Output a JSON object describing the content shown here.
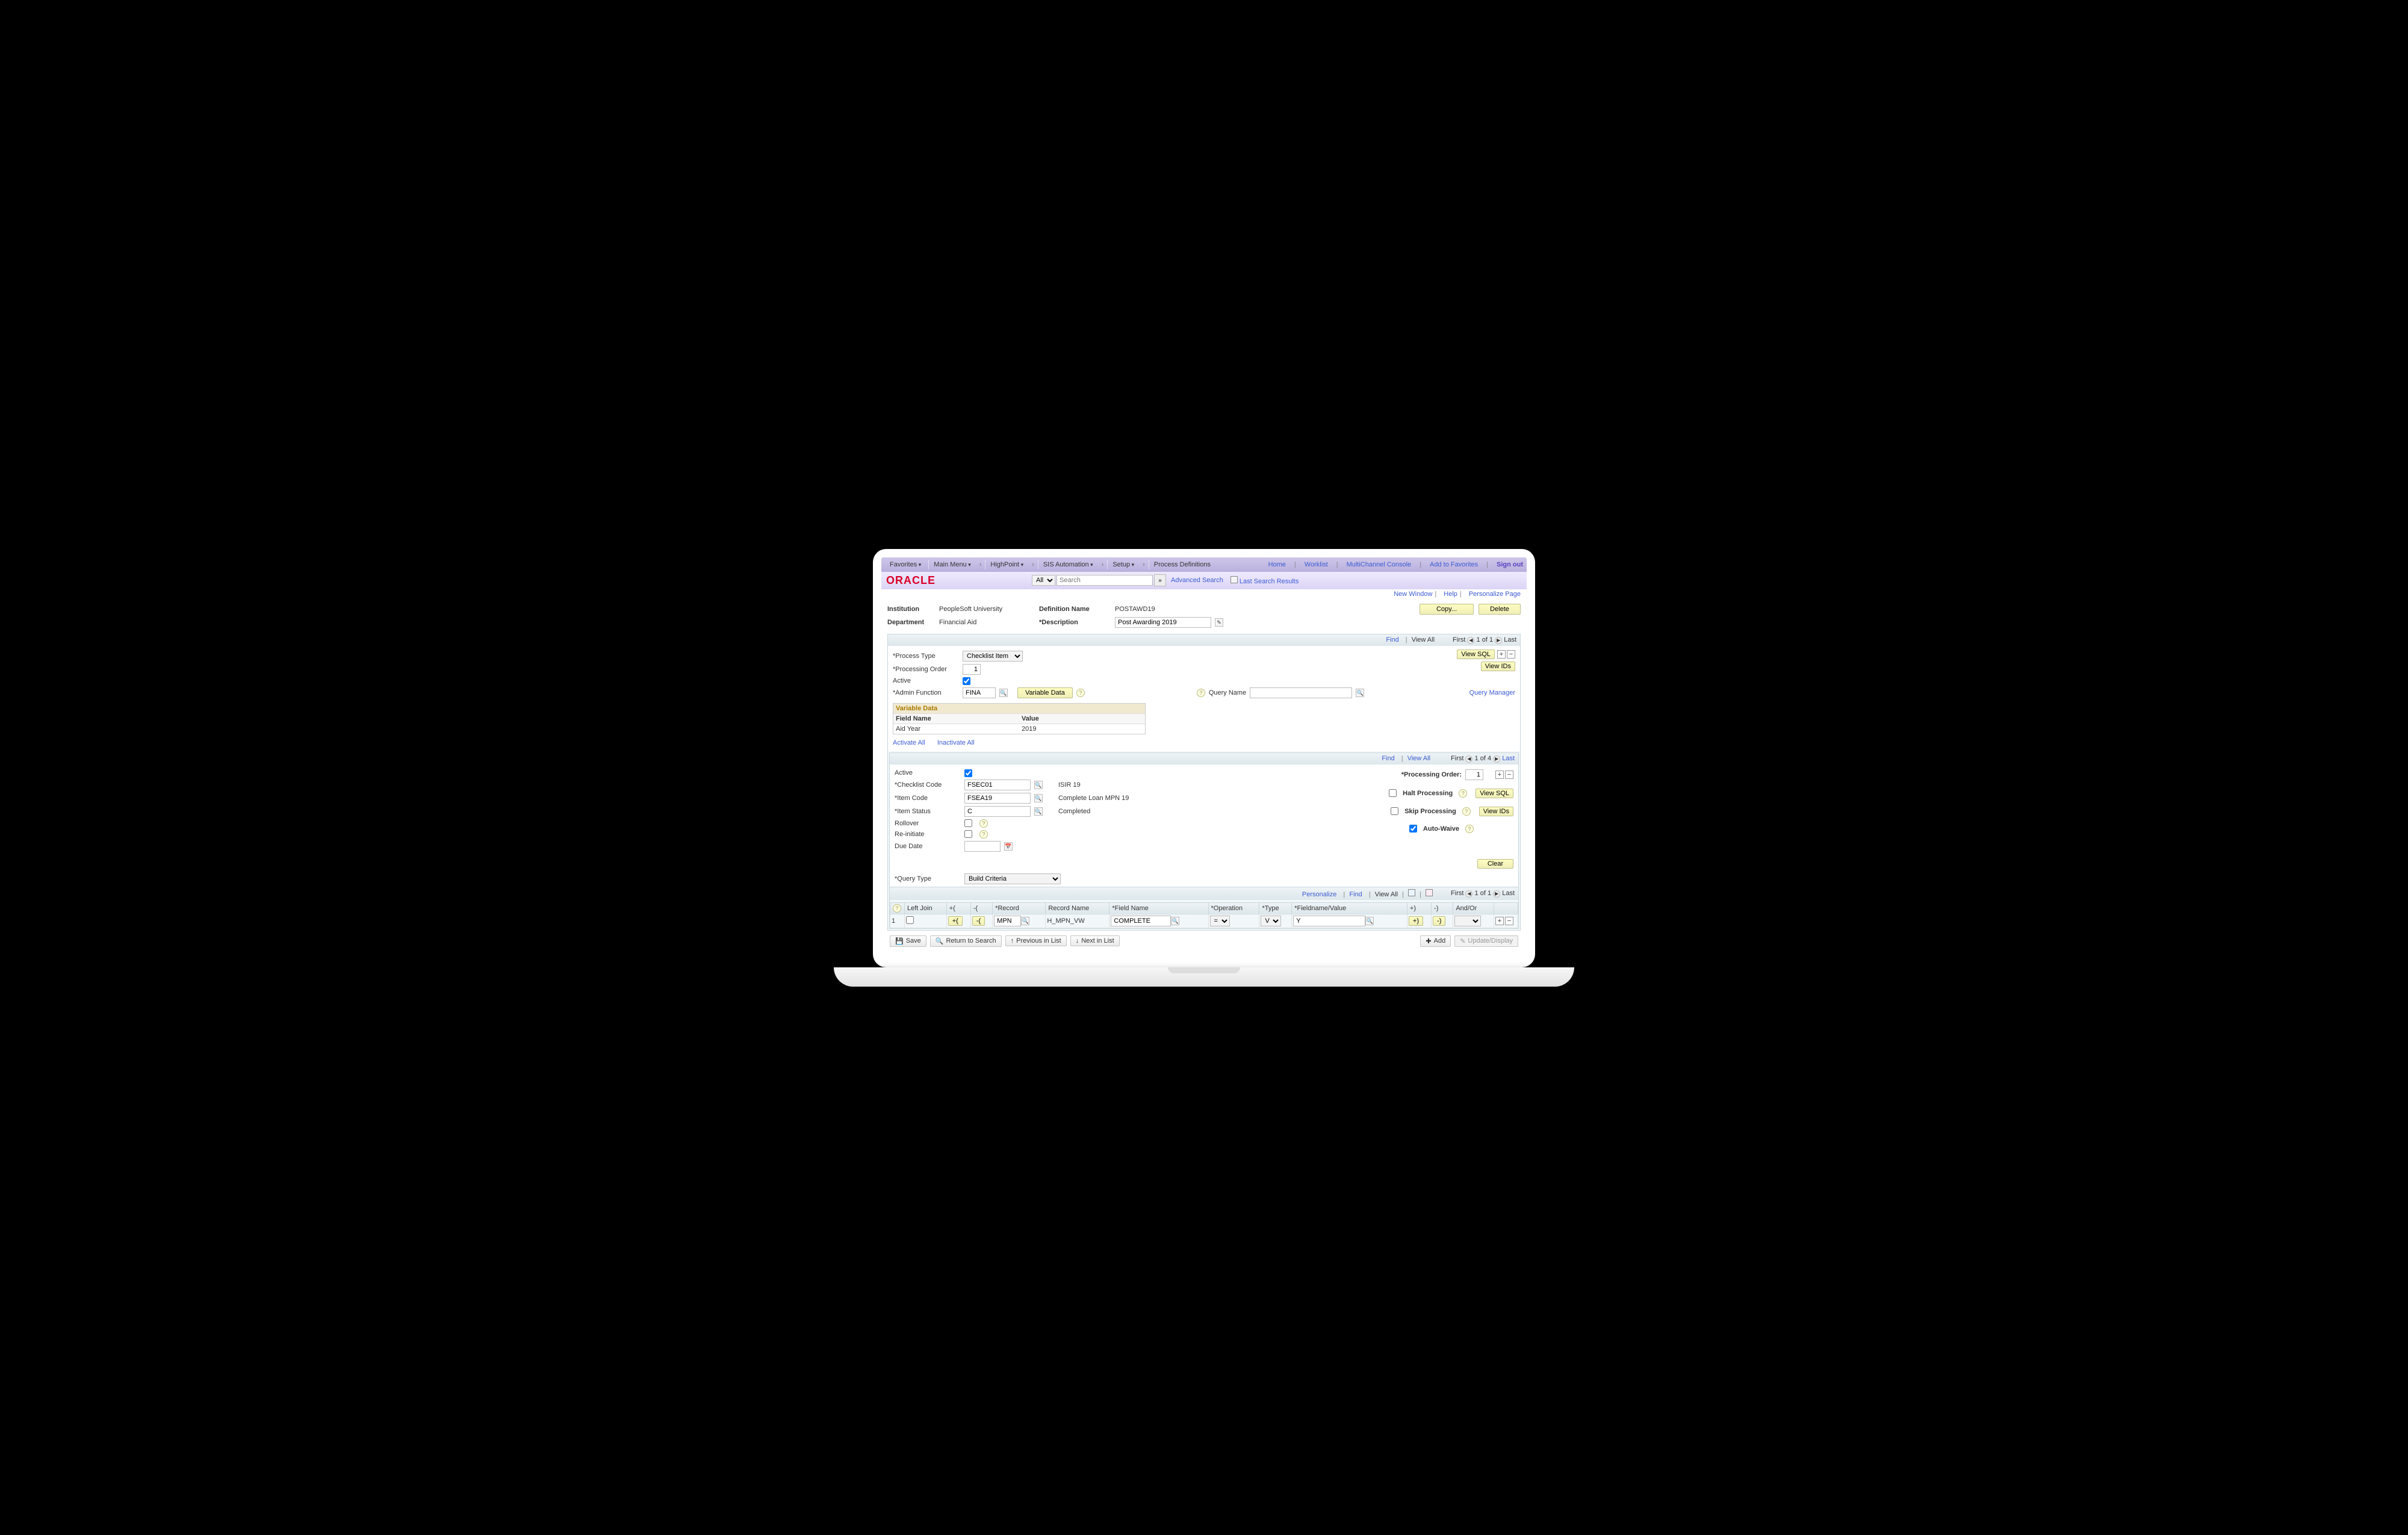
{
  "nav": {
    "favorites": "Favorites",
    "mainmenu": "Main Menu",
    "crumbs": [
      "HighPoint",
      "SIS Automation",
      "Setup",
      "Process Definitions"
    ]
  },
  "logo": "ORACLE",
  "search": {
    "scope": "All",
    "placeholder": "Search",
    "advanced": "Advanced Search",
    "last": "Last Search Results"
  },
  "toplinks": {
    "home": "Home",
    "worklist": "Worklist",
    "multichannel": "MultiChannel Console",
    "addfav": "Add to Favorites",
    "signout": "Sign out"
  },
  "pagelinks": {
    "newwin": "New Window",
    "help": "Help",
    "personalize": "Personalize Page"
  },
  "header": {
    "institution_lbl": "Institution",
    "institution_val": "PeopleSoft University",
    "department_lbl": "Department",
    "department_val": "Financial Aid",
    "defname_lbl": "Definition Name",
    "defname_val": "POSTAWD19",
    "desc_lbl": "*Description",
    "desc_val": "Post Awarding 2019",
    "copy": "Copy...",
    "delete": "Delete"
  },
  "topgrid": {
    "find": "Find",
    "viewall": "View All",
    "first": "First",
    "last": "Last",
    "pager": "1 of 1",
    "processtype_lbl": "*Process Type",
    "processtype_val": "Checklist Item",
    "procorder_lbl": "*Processing Order",
    "procorder_val": "1",
    "active_lbl": "Active",
    "adminfn_lbl": "*Admin Function",
    "adminfn_val": "FINA",
    "variabledata_btn": "Variable Data",
    "queryname_lbl": "Query Name",
    "querymgr": "Query Manager",
    "viewsql": "View SQL",
    "viewids": "View IDs",
    "vardata_header": "Variable Data",
    "vardata_field": "Field Name",
    "vardata_value": "Value",
    "vardata_rows": [
      [
        "Aid Year",
        "2019"
      ]
    ],
    "activate": "Activate All",
    "inactivate": "Inactivate All"
  },
  "detail": {
    "find": "Find",
    "viewall": "View All",
    "first": "First",
    "last": "Last",
    "pager": "1 of 4",
    "active_lbl": "Active",
    "procorder_lbl": "*Processing Order:",
    "procorder_val": "1",
    "checklist_lbl": "*Checklist Code",
    "checklist_val": "FSEC01",
    "checklist_desc": "ISIR 19",
    "item_lbl": "*Item Code",
    "item_val": "FSEA19",
    "item_desc": "Complete Loan MPN 19",
    "status_lbl": "*Item Status",
    "status_val": "C",
    "status_desc": "Completed",
    "rollover_lbl": "Rollover",
    "reinitiate_lbl": "Re-initiate",
    "duedate_lbl": "Due Date",
    "halt_lbl": "Halt Processing",
    "skip_lbl": "Skip Processing",
    "autowaive_lbl": "Auto-Waive",
    "viewsql": "View SQL",
    "viewids": "View IDs",
    "clear": "Clear",
    "querytype_lbl": "*Query Type",
    "querytype_val": "Build Criteria"
  },
  "criteria": {
    "personalize": "Personalize",
    "find": "Find",
    "viewall": "View All",
    "first": "First",
    "last": "Last",
    "pager": "1 of 1",
    "headers": {
      "rownum": "",
      "lj": "Left Join",
      "po": "+(",
      "pc": "-(",
      "rec": "*Record",
      "rn": "Record Name",
      "fn": "*Field Name",
      "op": "*Operation",
      "ty": "*Type",
      "fv": "*Fieldname/Value",
      "cp": "+)",
      "cm": "-)",
      "ao": "And/Or"
    },
    "row": {
      "num": "1",
      "po": "+(",
      "pc": "-(",
      "rec": "MPN",
      "rn": "H_MPN_VW",
      "fn": "COMPLETE",
      "op": "=",
      "ty": "V",
      "fv": "Y",
      "cp": "+)",
      "cm": "-)",
      "ao": ""
    }
  },
  "footer": {
    "save": "Save",
    "return": "Return to Search",
    "prev": "Previous in List",
    "next": "Next in List",
    "add": "Add",
    "update": "Update/Display"
  }
}
